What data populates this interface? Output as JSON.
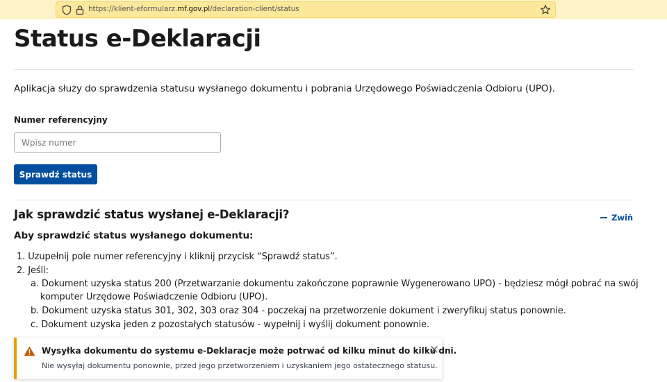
{
  "browser": {
    "url_prefix": "https://klient-eformularz.",
    "url_domain": "mf.gov.pl",
    "url_path": "/declaration-client/status"
  },
  "page": {
    "title": "Status e-Deklaracji",
    "intro": "Aplikacja służy do sprawdzenia statusu wysłanego dokumentu i pobrania Urzędowego Poświadczenia Odbioru (UPO)."
  },
  "form": {
    "label": "Numer referencyjny",
    "placeholder": "Wpisz numer",
    "value": "",
    "button_label": "Sprawdź status"
  },
  "help": {
    "title": "Jak sprawdzić status wysłanej e-Deklaracji?",
    "collapse_label": "Zwiń",
    "subheading": "Aby sprawdzić status wysłanego dokumentu:",
    "step1": "1. Uzupełnij pole numer referencyjny i kliknij przycisk “Sprawdź status”.",
    "step2": "2. Jeśli:",
    "step2a_line1": "a. Dokument uzyska status 200 (Przetwarzanie dokumentu zakończone poprawnie Wygenerowano UPO) - będziesz mógł pobrać na swój",
    "step2a_line2": "komputer Urzędowe Poświadczenie Odbioru (UPO).",
    "step2b": "b. Dokument uzyska status 301, 302, 303 oraz 304 - poczekaj na przetworzenie dokument i zweryfikuj status ponownie.",
    "step2c": "c. Dokument uzyska jeden z pozostałych statusów - wypełnij i wyślij dokument ponownie."
  },
  "alert": {
    "title": "Wysyłka dokumentu do systemu e-Deklaracje może potrwać od kilku minut do kilku dni.",
    "body": "Nie wysyłaj dokumentu ponownie, przed jego przetworzeniem i uzyskaniem jego ostatecznego statusu.",
    "accent_color": "#e5a000"
  },
  "colors": {
    "primary": "#004f9f",
    "urlbar": "#fbe89a"
  }
}
